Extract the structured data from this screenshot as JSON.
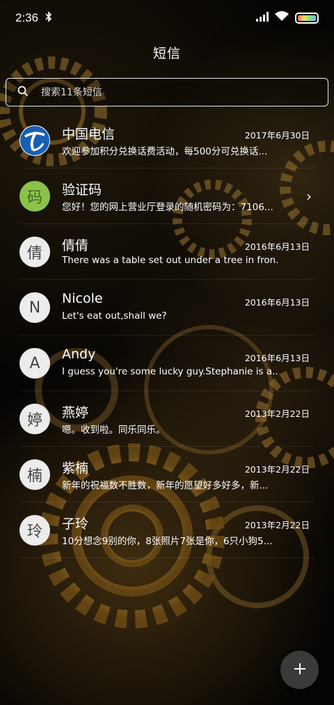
{
  "status_bar": {
    "time": "2:36",
    "bluetooth_icon": "bluetooth-icon",
    "signal_icon": "signal-icon",
    "wifi_icon": "wifi-icon",
    "battery_icon": "battery-icon"
  },
  "header": {
    "title": "短信"
  },
  "search": {
    "placeholder": "搜索11条短信",
    "icon": "search-icon"
  },
  "conversations": [
    {
      "avatar": "",
      "avatar_type": "china-telecom-logo",
      "name": "中国电信",
      "date": "2017年6月30日",
      "preview": "欢迎参加积分兑换话费活动，每500分可兑换话..."
    },
    {
      "avatar": "码",
      "name": "验证码",
      "date": "",
      "preview": "您好！您的网上营业厅登录的随机密码为：7106..."
    },
    {
      "avatar": "倩",
      "name": "倩倩",
      "date": "2016年6月13日",
      "preview": "There was a table set out under a tree in fron..."
    },
    {
      "avatar": "N",
      "name": "Nicole",
      "date": "2016年6月13日",
      "preview": "Let's eat out,shall we?"
    },
    {
      "avatar": "A",
      "name": "Andy",
      "date": "2016年6月13日",
      "preview": "I guess you're some lucky guy.Stephanie is a..."
    },
    {
      "avatar": "婷",
      "name": "燕婷",
      "date": "2013年2月22日",
      "preview": "嗯。收到啦。同乐同乐。"
    },
    {
      "avatar": "楠",
      "name": "紫楠",
      "date": "2013年2月22日",
      "preview": "新年的祝福数不胜数，新年的愿望好多好多，新..."
    },
    {
      "avatar": "玲",
      "name": "子玲",
      "date": "2013年2月22日",
      "preview": "10分想念9别的你，8张照片7张是你，6只小狗5..."
    }
  ],
  "fab": {
    "icon": "plus-icon"
  },
  "colors": {
    "accent_green": "#8bc34a",
    "telecom_blue": "#1a5fb4",
    "fab_bg": "#3a3a3a"
  }
}
